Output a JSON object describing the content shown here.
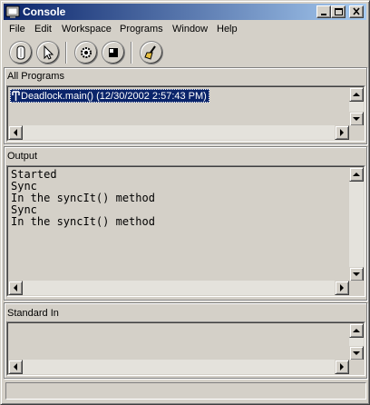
{
  "window": {
    "title": "Console"
  },
  "menu": [
    "File",
    "Edit",
    "Workspace",
    "Programs",
    "Window",
    "Help"
  ],
  "toolbar": {
    "buttons": [
      "clear-icon",
      "pointer-icon",
      "gear-icon",
      "stop-icon",
      "broom-icon"
    ]
  },
  "all_programs": {
    "label": "All Programs",
    "items": [
      {
        "text": "Deadlock.main() (12/30/2002 2:57:43 PM)",
        "selected": true
      }
    ]
  },
  "output": {
    "label": "Output",
    "lines": [
      "Started",
      "Sync",
      "In the syncIt() method",
      "Sync",
      "In the syncIt() method"
    ]
  },
  "standard_in": {
    "label": "Standard In",
    "value": ""
  },
  "colors": {
    "titlebar_start": "#0a246a",
    "titlebar_end": "#a6caf0",
    "selection": "#0a246a",
    "face": "#d4d0c8"
  }
}
